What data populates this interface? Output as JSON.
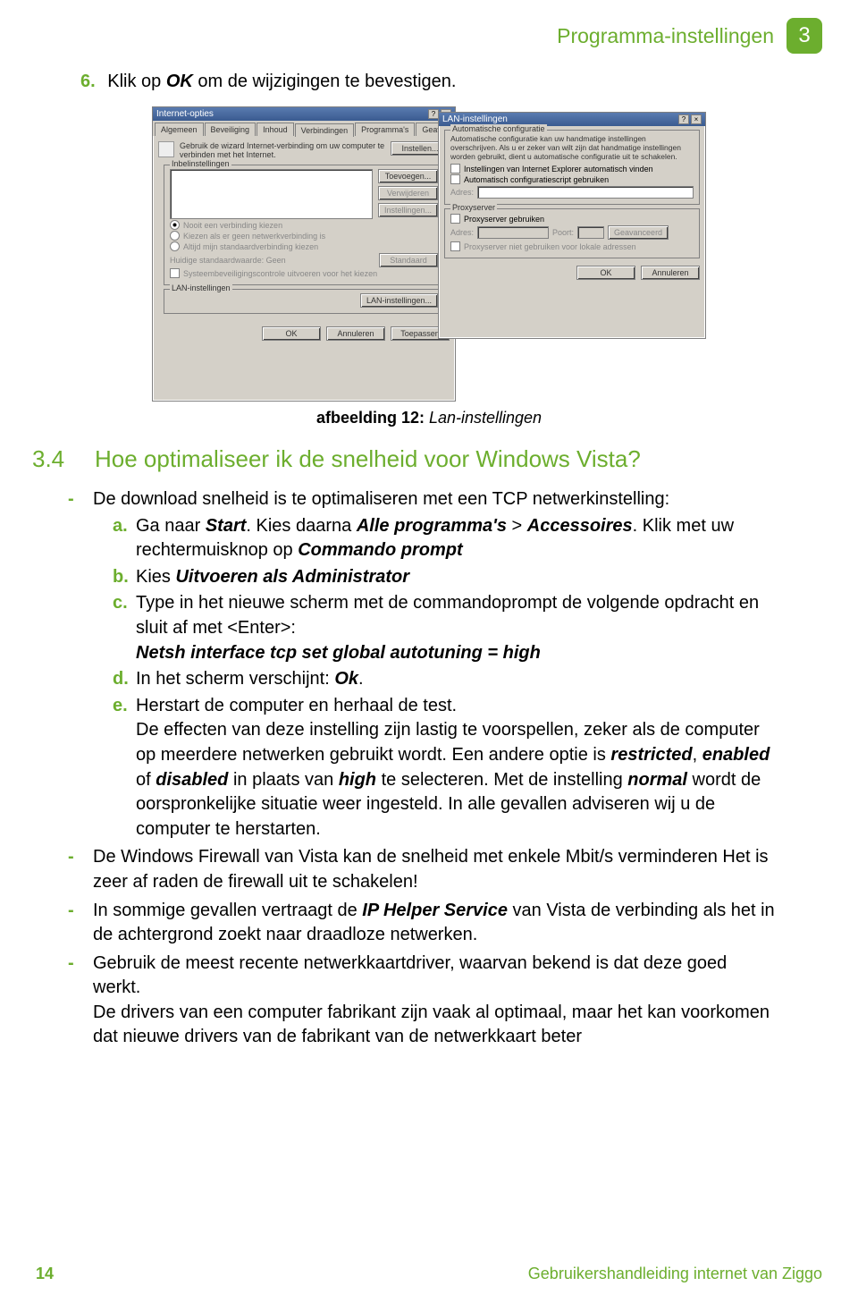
{
  "header": {
    "title": "Programma-instellingen",
    "chapter": "3"
  },
  "step6": {
    "num": "6.",
    "text_pre": "Klik op ",
    "ok": "OK",
    "text_post": " om de wijzigingen te bevestigen."
  },
  "mock": {
    "win1": {
      "title": "Internet-opties",
      "tabs": [
        "Algemeen",
        "Beveiliging",
        "Inhoud",
        "Verbindingen",
        "Programma's",
        "Geavan"
      ],
      "active_tab": 3,
      "wizard_text": "Gebruik de wizard Internet-verbinding om uw computer te verbinden met het Internet.",
      "btn_instellen": "Instellen...",
      "fieldset1": "Inbelinstellingen",
      "btn_toevoegen": "Toevoegen...",
      "btn_verwijderen": "Verwijderen",
      "btn_instellingen": "Instellingen...",
      "radio1": "Nooit een verbinding kiezen",
      "radio2": "Kiezen als er geen netwerkverbinding is",
      "radio3": "Altijd mijn standaardverbinding kiezen",
      "std_label": "Huidige standaardwaarde:",
      "std_val": "Geen",
      "btn_std": "Standaard",
      "chk1": "Systeembeveiligingscontrole uitvoeren voor het kiezen",
      "fieldset2": "LAN-instellingen",
      "btn_lan": "LAN-instellingen...",
      "btn_ok": "OK",
      "btn_cancel": "Annuleren",
      "btn_apply": "Toepassen"
    },
    "win2": {
      "title": "LAN-instellingen",
      "fs1": "Automatische configuratie",
      "fs1_text": "Automatische configuratie kan uw handmatige instellingen overschrijven. Als u er zeker van wilt zijn dat handmatige instellingen worden gebruikt, dient u automatische configuratie uit te schakelen.",
      "chk_auto1": "Instellingen van Internet Explorer automatisch vinden",
      "chk_auto2": "Automatisch configuratiescript gebruiken",
      "adres_label": "Adres:",
      "fs2": "Proxyserver",
      "chk_proxy": "Proxyserver gebruiken",
      "adres2": "Adres:",
      "poort": "Poort:",
      "btn_adv": "Geavanceerd",
      "chk_local": "Proxyserver niet gebruiken voor lokale adressen",
      "btn_ok": "OK",
      "btn_cancel": "Annuleren"
    }
  },
  "caption": {
    "label": "afbeelding 12:",
    "text": " Lan-instellingen"
  },
  "section34": {
    "num": "3.4",
    "title": "Hoe optimaliseer ik de snelheid voor Windows Vista?"
  },
  "bullets": {
    "b1": {
      "intro": "De download snelheid is te optimaliseren met een TCP netwerkinstelling:",
      "a_pre": "Ga naar ",
      "a_b1": "Start",
      "a_mid": ". Kies daarna ",
      "a_b2": "Alle programma's",
      "a_gt": " > ",
      "a_b3": "Accessoires",
      "a_post": ". Klik met uw rechtermuisknop op ",
      "a_b4": "Commando prompt",
      "b_pre": "Kies ",
      "b_b": "Uitvoeren als Administrator",
      "c_line1": "Type in het nieuwe scherm met de commandoprompt de volgende opdracht en sluit af met <Enter>:",
      "c_cmd": "Netsh interface tcp set global autotuning = high",
      "d_pre": "In het scherm verschijnt: ",
      "d_b": "Ok",
      "d_post": ".",
      "e_line1": "Herstart de computer en herhaal de test.",
      "e_para_pre": "De effecten van deze instelling zijn lastig te voorspellen, zeker als de computer op meerdere netwerken gebruikt wordt. Een andere optie is ",
      "e_w1": "restricted",
      "e_c1": ", ",
      "e_w2": "enabled",
      "e_c2": " of ",
      "e_w3": "disabled",
      "e_mid": " in plaats van ",
      "e_w4": "high",
      "e_sel": " te selecteren. Met de instelling ",
      "e_w5": "normal",
      "e_post": " wordt de oorspronkelijke situatie weer ingesteld. In alle gevallen adviseren wij u de computer te herstarten."
    },
    "b2": "De Windows Firewall van Vista kan de snelheid met enkele Mbit/s verminderen Het is zeer af raden de firewall uit te schakelen!",
    "b3_pre": "In sommige gevallen vertraagt de ",
    "b3_b": "IP Helper Service",
    "b3_post": " van Vista de verbinding als het in de achtergrond zoekt naar draadloze netwerken.",
    "b4_line1": "Gebruik de meest recente netwerkkaartdriver, waarvan bekend is dat deze goed werkt.",
    "b4_line2": "De drivers van een computer fabrikant zijn vaak al optimaal, maar het kan voorkomen dat nieuwe drivers van de fabrikant van de netwerkkaart beter"
  },
  "footer": {
    "page": "14",
    "doc": "Gebruikershandleiding internet van Ziggo"
  }
}
